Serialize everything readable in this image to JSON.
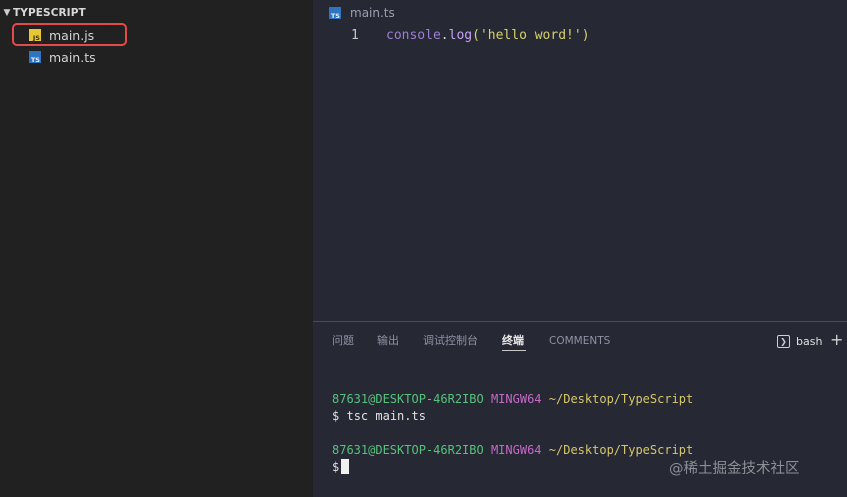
{
  "sidebar": {
    "section_title": "TYPESCRIPT",
    "files": [
      {
        "name": "main.js",
        "icon_label": "JS",
        "icon": "js-file-icon",
        "highlighted": true
      },
      {
        "name": "main.ts",
        "icon_label": "TS",
        "icon": "ts-file-icon",
        "highlighted": false
      }
    ],
    "highlight_color": "#e34b4b"
  },
  "editor": {
    "tab": {
      "name": "main.ts",
      "icon_label": "TS"
    },
    "line_number": "1",
    "code": {
      "object": "console",
      "dot": ".",
      "method": "log",
      "open": "(",
      "string": "'hello word!'",
      "close": ")"
    }
  },
  "panel": {
    "tabs": [
      {
        "label": "问题",
        "active": false
      },
      {
        "label": "输出",
        "active": false
      },
      {
        "label": "调试控制台",
        "active": false
      },
      {
        "label": "终端",
        "active": true
      },
      {
        "label": "COMMENTS",
        "active": false
      }
    ],
    "shell": "bash",
    "new_terminal": "+"
  },
  "terminal": {
    "blocks": [
      {
        "user": "87631@DESKTOP-46R2IBO",
        "env": "MINGW64",
        "path": "~/Desktop/TypeScript",
        "prompt": "$",
        "command": "tsc main.ts"
      },
      {
        "user": "87631@DESKTOP-46R2IBO",
        "env": "MINGW64",
        "path": "~/Desktop/TypeScript",
        "prompt": "$",
        "command": ""
      }
    ]
  },
  "watermark": "@稀土掘金技术社区",
  "colors": {
    "sidebar_bg": "#212121",
    "editor_bg": "#262833",
    "user": "#57c27d",
    "env": "#c66ac8",
    "path": "#d7c86a"
  }
}
